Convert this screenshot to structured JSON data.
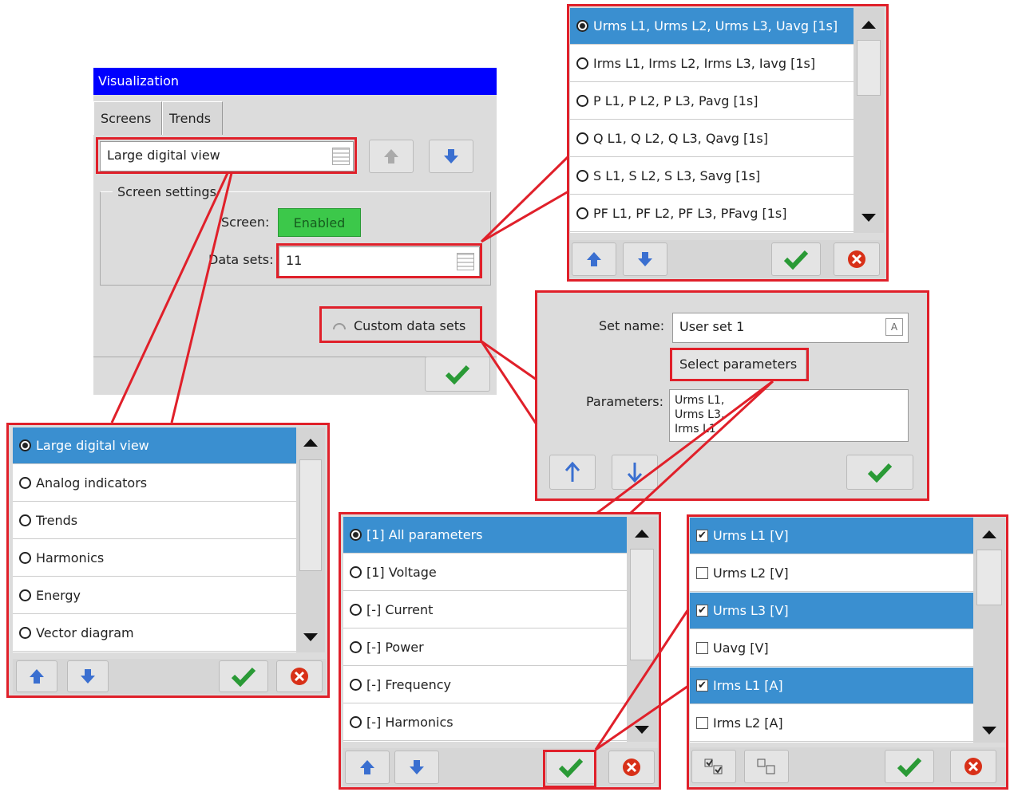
{
  "visualization": {
    "title": "Visualization",
    "tabs": [
      "Screens",
      "Trends"
    ],
    "screen_select": "Large digital view",
    "group_label": "Screen settings",
    "screen_label": "Screen:",
    "screen_value": "Enabled",
    "datasets_label": "Data sets:",
    "datasets_value": "11",
    "custom_label": "Custom data sets"
  },
  "screen_list": {
    "items": [
      "Large digital view",
      "Analog indicators",
      "Trends",
      "Harmonics",
      "Energy",
      "Vector diagram"
    ],
    "selected": 0
  },
  "dataset_list": {
    "items": [
      "Urms L1, Urms L2, Urms L3, Uavg [1s]",
      "Irms L1, Irms L2, Irms L3, Iavg [1s]",
      "P L1, P L2, P L3, Pavg [1s]",
      "Q L1, Q L2, Q L3, Qavg [1s]",
      "S L1, S L2, S L3, Savg [1s]",
      "PF L1, PF L2, PF L3, PFavg [1s]"
    ],
    "selected": 0
  },
  "custom_set": {
    "setname_label": "Set name:",
    "setname_value": "User set 1",
    "select_button": "Select parameters",
    "params_label": "Parameters:",
    "params_lines": [
      "Urms L1,",
      "Urms L3,",
      "Irms L1"
    ]
  },
  "param_groups": {
    "items": [
      "[1] All parameters",
      "[1] Voltage",
      "[-] Current",
      "[-] Power",
      "[-] Frequency",
      "[-] Harmonics"
    ],
    "selected": 0
  },
  "param_check": {
    "items": [
      {
        "label": "Urms L1 [V]",
        "checked": true
      },
      {
        "label": "Urms L2 [V]",
        "checked": false
      },
      {
        "label": "Urms L3 [V]",
        "checked": true
      },
      {
        "label": "Uavg [V]",
        "checked": false
      },
      {
        "label": "Irms L1 [A]",
        "checked": true
      },
      {
        "label": "Irms L2 [A]",
        "checked": false
      }
    ]
  },
  "colors": {
    "accent": "#3a8fd0",
    "highlight": "#e0202a",
    "title_bar": "#0000ff",
    "enabled": "#3cc84a"
  }
}
